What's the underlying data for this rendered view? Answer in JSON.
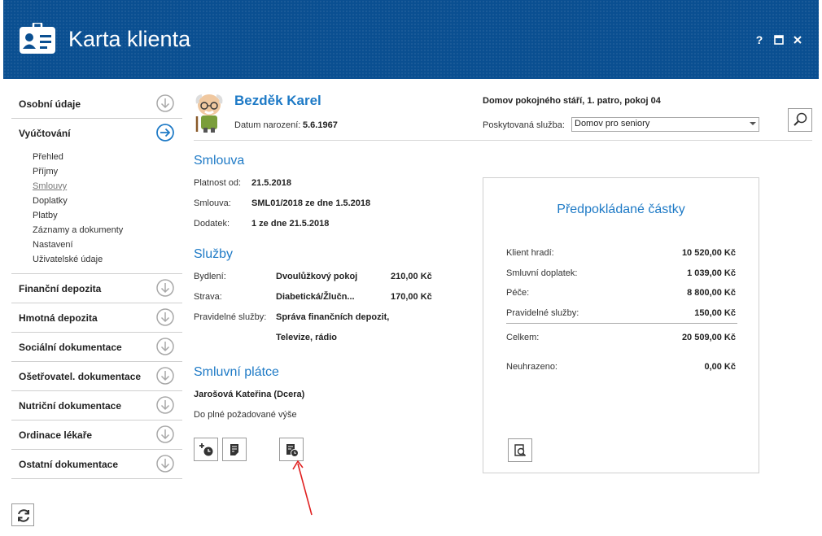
{
  "window": {
    "title": "Karta klienta",
    "help_label": "?",
    "header_color": "#0a4f91",
    "accent_color": "#1e7ac6"
  },
  "sidebar": {
    "items": [
      {
        "label": "Osobní údaje",
        "icon": "arrow-down-circle-icon"
      },
      {
        "label": "Vyúčtování",
        "icon": "arrow-right-circle-icon",
        "active": true
      },
      {
        "label": "Finanční depozita",
        "icon": "arrow-down-circle-icon"
      },
      {
        "label": "Hmotná depozita",
        "icon": "arrow-down-circle-icon"
      },
      {
        "label": "Sociální dokumentace",
        "icon": "arrow-down-circle-icon"
      },
      {
        "label": "Ošetřovatel. dokumentace",
        "icon": "arrow-down-circle-icon"
      },
      {
        "label": "Nutriční dokumentace",
        "icon": "arrow-down-circle-icon"
      },
      {
        "label": "Ordinace lékaře",
        "icon": "arrow-down-circle-icon"
      },
      {
        "label": "Ostatní dokumentace",
        "icon": "arrow-down-circle-icon"
      }
    ],
    "subitems": [
      "Přehled",
      "Příjmy",
      "Smlouvy",
      "Doplatky",
      "Platby",
      "Záznamy a dokumenty",
      "Nastavení",
      "Uživatelské údaje"
    ],
    "current_subitem": "Smlouvy"
  },
  "client": {
    "name": "Bezděk Karel",
    "dob_label": "Datum narození:",
    "dob": "5.6.1967",
    "facility": "Domov pokojného stáří, 1. patro, pokoj 04",
    "service_label": "Poskytovaná služba:",
    "service_value": "Domov pro seniory"
  },
  "contract": {
    "title": "Smlouva",
    "valid_from_label": "Platnost od:",
    "valid_from": "21.5.2018",
    "contract_label": "Smlouva:",
    "contract_value": "SML01/2018 ze dne 1.5.2018",
    "addendum_label": "Dodatek:",
    "addendum_value": "1 ze dne 21.5.2018"
  },
  "services": {
    "title": "Služby",
    "housing_label": "Bydlení:",
    "housing_value": "Dvoulůžkový pokoj",
    "housing_price": "210,00 Kč",
    "food_label": "Strava:",
    "food_value": "Diabetická/Žlučn...",
    "food_price": "170,00 Kč",
    "regular_label": "Pravidelné služby:",
    "regular_value_1": "Správa finančních depozit,",
    "regular_value_2": "Televize, rádio"
  },
  "payer": {
    "title": "Smluvní plátce",
    "name": "Jarošová Kateřina (Dcera)",
    "note": "Do plné požadované výše"
  },
  "estimates": {
    "title": "Předpokládané částky",
    "rows": [
      {
        "label": "Klient hradí:",
        "value": "10 520,00 Kč"
      },
      {
        "label": "Smluvní doplatek:",
        "value": "1 039,00 Kč"
      },
      {
        "label": "Péče:",
        "value": "8 800,00 Kč"
      },
      {
        "label": "Pravidelné služby:",
        "value": "150,00 Kč"
      }
    ],
    "total_label": "Celkem:",
    "total_value": "20 509,00 Kč",
    "unpaid_label": "Neuhrazeno:",
    "unpaid_value": "0,00 Kč"
  },
  "annotation": {
    "arrow_color": "#e02020"
  }
}
